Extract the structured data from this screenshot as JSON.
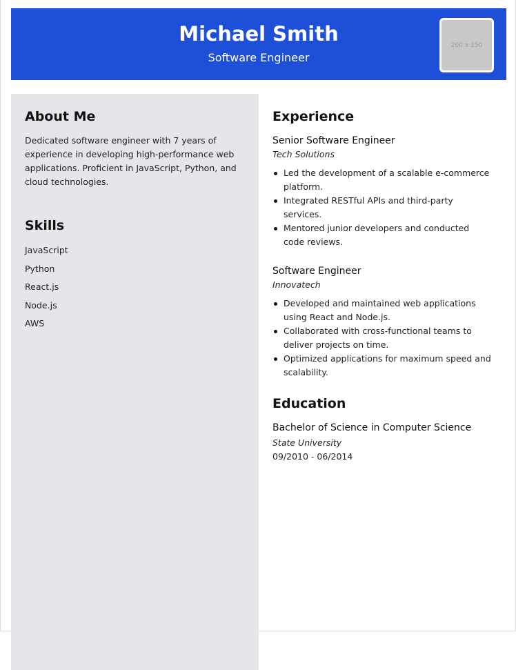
{
  "header": {
    "name": "Michael Smith",
    "role": "Software Engineer",
    "photo_placeholder": "200 x 150",
    "background_color": "#1d4fd8"
  },
  "sidebar": {
    "background_color": "#e5e6ea",
    "about": {
      "title": "About Me",
      "text": "Dedicated software engineer with 7 years of experience in developing high-performance web applications. Proficient in JavaScript, Python, and cloud technologies."
    },
    "skills": {
      "title": "Skills",
      "items": [
        "JavaScript",
        "Python",
        "React.js",
        "Node.js",
        "AWS"
      ]
    }
  },
  "experience": {
    "title": "Experience",
    "jobs": [
      {
        "title": "Senior Software Engineer",
        "company": "Tech Solutions",
        "duties": [
          "Led the development of a scalable e-commerce platform.",
          "Integrated RESTful APIs and third-party services.",
          "Mentored junior developers and conducted code reviews."
        ]
      },
      {
        "title": "Software Engineer",
        "company": "Innovatech",
        "duties": [
          "Developed and maintained web applications using React and Node.js.",
          "Collaborated with cross-functional teams to deliver projects on time.",
          "Optimized applications for maximum speed and scalability."
        ]
      }
    ]
  },
  "education": {
    "title": "Education",
    "degree": "Bachelor of Science in Computer Science",
    "school": "State University",
    "dates": "09/2010 - 06/2014"
  }
}
